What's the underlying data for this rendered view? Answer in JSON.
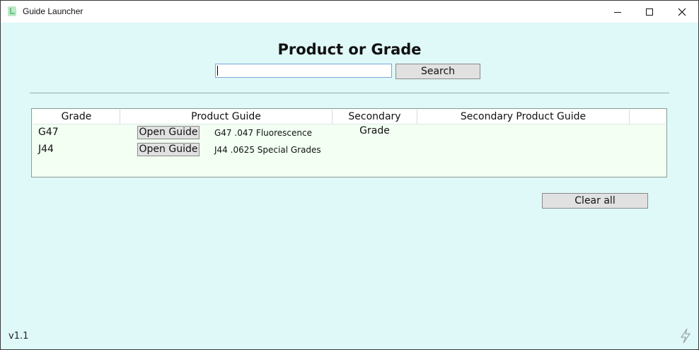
{
  "window": {
    "title": "Guide Launcher",
    "accent": "#dff8f8"
  },
  "header": {
    "heading": "Product or Grade"
  },
  "search": {
    "value": "",
    "button_label": "Search"
  },
  "table": {
    "columns": [
      "Grade",
      "Product Guide",
      "Secondary Grade",
      "Secondary Product Guide"
    ],
    "rows": [
      {
        "grade": "G47",
        "button": "Open Guide",
        "guide": "G47 .047 Fluorescence"
      },
      {
        "grade": "J44",
        "button": "Open Guide",
        "guide": "J44 .0625 Special Grades"
      }
    ]
  },
  "actions": {
    "clear_label": "Clear all"
  },
  "footer": {
    "version": "v1.1"
  }
}
